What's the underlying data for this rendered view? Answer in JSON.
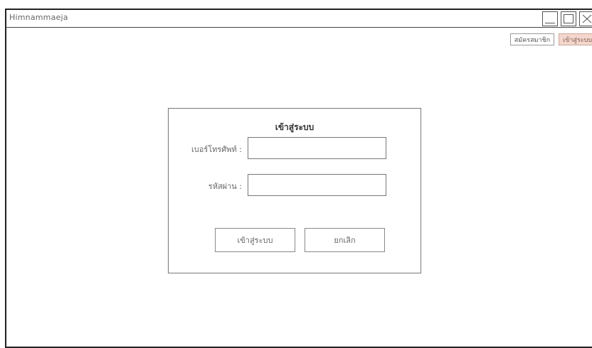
{
  "window": {
    "title": "Himnammaeja"
  },
  "header_actions": {
    "register_label": "สมัครสมาชิก",
    "login_label": "เข้าสู่ระบบ"
  },
  "login_form": {
    "title": "เข้าสู่ระบบ",
    "phone_label": "เบอร์โทรศัพท์ :",
    "phone_value": "",
    "password_label": "รหัสผ่าน :",
    "password_value": "",
    "submit_label": "เข้าสู่ระบบ",
    "cancel_label": "ยกเลิก"
  },
  "colors": {
    "active_tab_bg": "#f5d6cd",
    "frame_border": "#222222"
  },
  "icons": {
    "minimize": "minimize-icon",
    "maximize": "maximize-icon",
    "close": "close-icon"
  }
}
